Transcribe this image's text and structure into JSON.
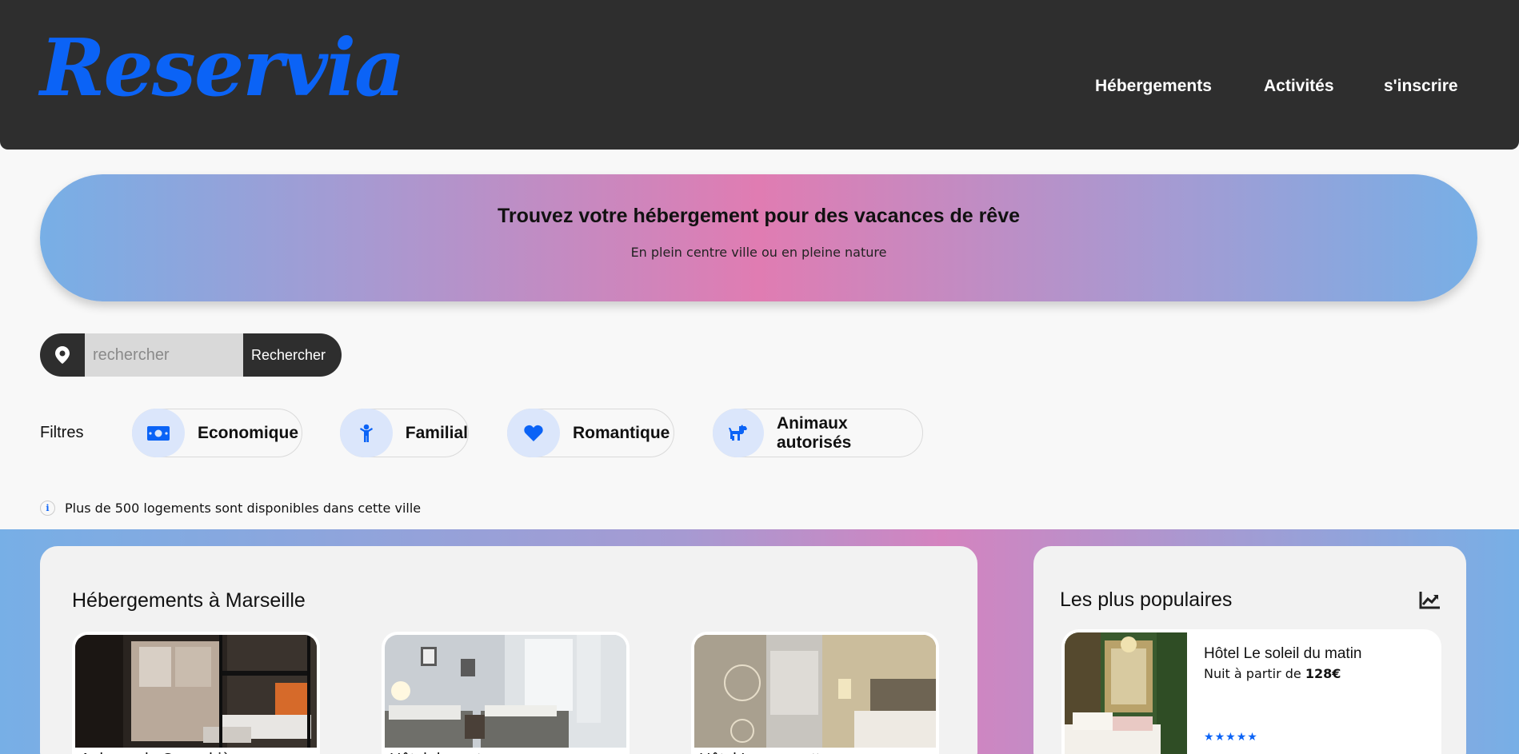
{
  "brand": {
    "logo": "Reservia",
    "accent_color": "#0b63f6"
  },
  "nav": {
    "items": [
      "Hébergements",
      "Activités",
      "s'inscrire"
    ]
  },
  "hero": {
    "title": "Trouvez votre hébergement pour des vacances de rêve",
    "subtitle": "En plein centre ville ou en pleine nature"
  },
  "search": {
    "placeholder": "rechercher",
    "value": "",
    "button_label": "Rechercher",
    "icon": "location-pin-icon"
  },
  "filters": {
    "label": "Filtres",
    "items": [
      {
        "label": "Economique",
        "icon": "money-icon"
      },
      {
        "label": "Familial",
        "icon": "child-icon"
      },
      {
        "label": "Romantique",
        "icon": "heart-icon"
      },
      {
        "label": "Animaux autorisés",
        "icon": "dog-icon"
      }
    ]
  },
  "info": {
    "icon": "info-icon",
    "text": "Plus de 500 logements sont disponibles dans cette ville"
  },
  "accommodations": {
    "title": "Hébergements à Marseille",
    "cards": [
      {
        "name": "Auberge la Cannebière"
      },
      {
        "name": "Hôtel du port"
      },
      {
        "name": "Hôtel Les mouettes"
      }
    ]
  },
  "popular": {
    "title": "Les plus populaires",
    "icon": "trending-up-icon",
    "items": [
      {
        "name": "Hôtel Le soleil du matin",
        "price_prefix": "Nuit à partir de ",
        "price": "128€",
        "rating": 5
      }
    ]
  }
}
